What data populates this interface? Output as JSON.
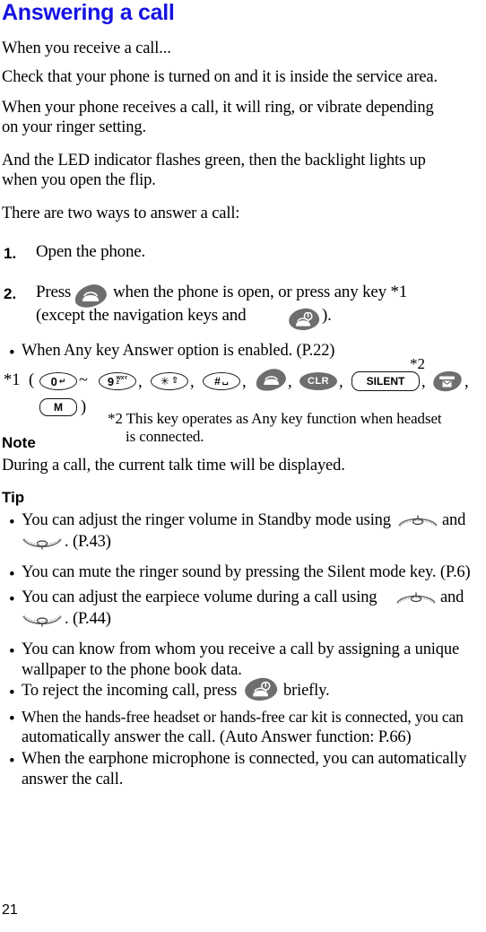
{
  "document": {
    "title": "Answering a call",
    "title_color": "#1512e2",
    "page_number": "21"
  },
  "intro": {
    "line1": "When you receive a call...",
    "line2": "Check that your phone is turned on and it is inside the service area.",
    "line3a": "When your phone receives a call, it will ring, or vibrate depending",
    "line3b": "on your ringer setting.",
    "line4a": "And the LED indicator flashes green, then the backlight lights up",
    "line4b": "when you open the flip.",
    "line5": "There are two ways to answer a call:"
  },
  "steps": [
    {
      "number": "1.",
      "text": "Open the phone."
    },
    {
      "number": "2.",
      "text_before_icon": "Press",
      "icon": "send-key-icon",
      "text_after_icon": "when the phone is open, or press any key *1",
      "line2_before_icon": "(except the navigation keys and",
      "line2_icon": "end-key-icon",
      "line2_after_icon": ")."
    }
  ],
  "anykey_note": {
    "bullet": "•",
    "text": "When Any key Answer option is enabled. (P.22)"
  },
  "footnote1": {
    "label": "*1",
    "open_paren": "(",
    "range_dash": "~",
    "close_paren": ")",
    "keys": [
      {
        "name": "key-0",
        "main": "0",
        "sub": "",
        "glyph": "↵"
      },
      {
        "name": "key-9",
        "main": "9",
        "sub_top": "WXY",
        "sub_bottom": "Z",
        "glyph": ""
      },
      {
        "name": "key-star",
        "main": "✳",
        "glyph": "⇧"
      },
      {
        "name": "key-hash",
        "main": "#",
        "glyph": "␣"
      },
      {
        "name": "key-send",
        "main": ""
      },
      {
        "name": "key-clr",
        "main": "CLR"
      },
      {
        "name": "key-silent",
        "main": "SILENT"
      },
      {
        "name": "key-mail",
        "main": ""
      },
      {
        "name": "key-m",
        "main": "M"
      }
    ],
    "separator": ","
  },
  "footnote2": {
    "marker": "*2",
    "line1": "*2 This key operates as Any key function when headset",
    "line2": "is connected."
  },
  "note": {
    "heading": "Note",
    "text": "During a call, the current talk time will be displayed."
  },
  "tip": {
    "heading": "Tip",
    "bullet": "•",
    "items": [
      {
        "line1_before": "You can adjust the ringer volume in Standby mode using",
        "icon1": "volume-up-icon",
        "line1_mid": "and",
        "icon2": "volume-down-icon",
        "line2_after": ". (P.43)"
      },
      {
        "line1": "You can mute the ringer sound by pressing the Silent mode key. (P.6)"
      },
      {
        "line1_before": "You can adjust the earpiece volume during a call using",
        "icon1": "volume-up-icon",
        "line1_mid": "and",
        "icon2": "volume-down-icon",
        "line2_after": ". (P.44)"
      },
      {
        "line1": "You can know from whom you receive a call by assigning a unique",
        "line2": "wallpaper to the phone book data."
      },
      {
        "line1_before": "To reject the incoming call, press",
        "icon1": "end-key-icon",
        "line1_after": "briefly."
      },
      {
        "line1": "When the hands-free headset or hands-free car kit is connected, you can",
        "line2": "automatically answer the call. (Auto Answer function: P.66)"
      },
      {
        "line1": "When the earphone microphone is connected, you can automatically",
        "line2": "answer the call."
      }
    ]
  }
}
